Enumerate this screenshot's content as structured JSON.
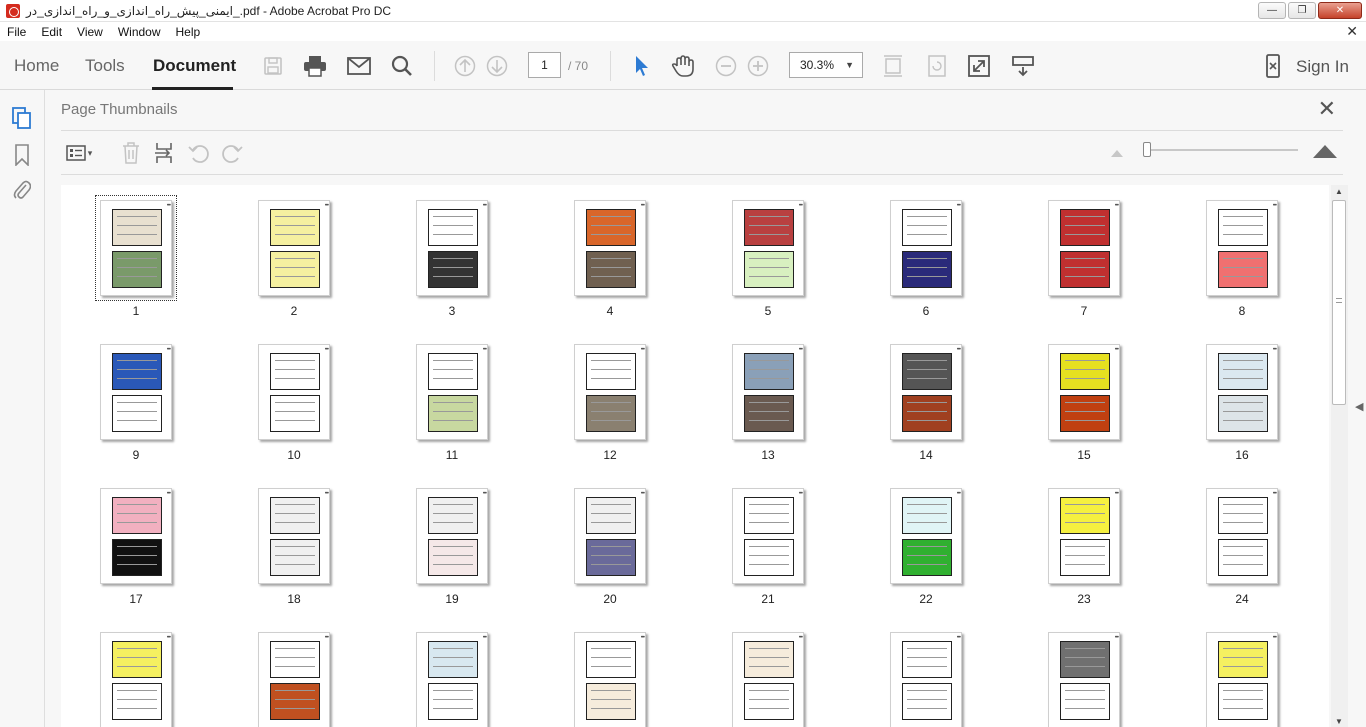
{
  "window": {
    "title": "ایمنی_پیش_راه_اندازی_و_راه_اندازی_در_.pdf - Adobe Acrobat Pro DC",
    "controls": {
      "minimize": "—",
      "restore": "❐",
      "close": "✕"
    }
  },
  "menu": {
    "items": [
      "File",
      "Edit",
      "View",
      "Window",
      "Help"
    ],
    "close": "✕"
  },
  "toolbar": {
    "tabs": [
      "Home",
      "Tools",
      "Document"
    ],
    "active_tab": "Document",
    "page_current": "1",
    "page_total": "/ 70",
    "zoom": "30.3%",
    "sign_in": "Sign In",
    "icons": [
      "save-icon",
      "print-icon",
      "mail-icon",
      "search-icon",
      "page-up-icon",
      "page-down-icon",
      "select-arrow-icon",
      "hand-tool-icon",
      "zoom-out-icon",
      "zoom-in-icon",
      "fit-page-icon",
      "rotate-page-icon",
      "full-screen-icon",
      "read-mode-icon",
      "mobile-icon"
    ]
  },
  "rail": {
    "icons": [
      "page-thumbnails-icon",
      "bookmark-icon",
      "attachment-icon"
    ]
  },
  "panel": {
    "title": "Page Thumbnails",
    "close": "✕",
    "options_caret": "▾"
  },
  "thumbnails": [
    {
      "label": "1"
    },
    {
      "label": "2"
    },
    {
      "label": "3"
    },
    {
      "label": "4"
    },
    {
      "label": "5"
    },
    {
      "label": "6"
    },
    {
      "label": "7"
    },
    {
      "label": "8"
    },
    {
      "label": "9"
    },
    {
      "label": "10"
    },
    {
      "label": "11"
    },
    {
      "label": "12"
    },
    {
      "label": "13"
    },
    {
      "label": "14"
    },
    {
      "label": "15"
    },
    {
      "label": "16"
    },
    {
      "label": "17"
    },
    {
      "label": "18"
    },
    {
      "label": "19"
    },
    {
      "label": "20"
    },
    {
      "label": "21"
    },
    {
      "label": "22"
    },
    {
      "label": "23"
    },
    {
      "label": "24"
    },
    {
      "label": ""
    },
    {
      "label": ""
    },
    {
      "label": ""
    },
    {
      "label": ""
    },
    {
      "label": ""
    },
    {
      "label": ""
    },
    {
      "label": ""
    },
    {
      "label": ""
    }
  ],
  "colors": {
    "accent": "#2d7bd3",
    "selected_outline": "#333333"
  }
}
